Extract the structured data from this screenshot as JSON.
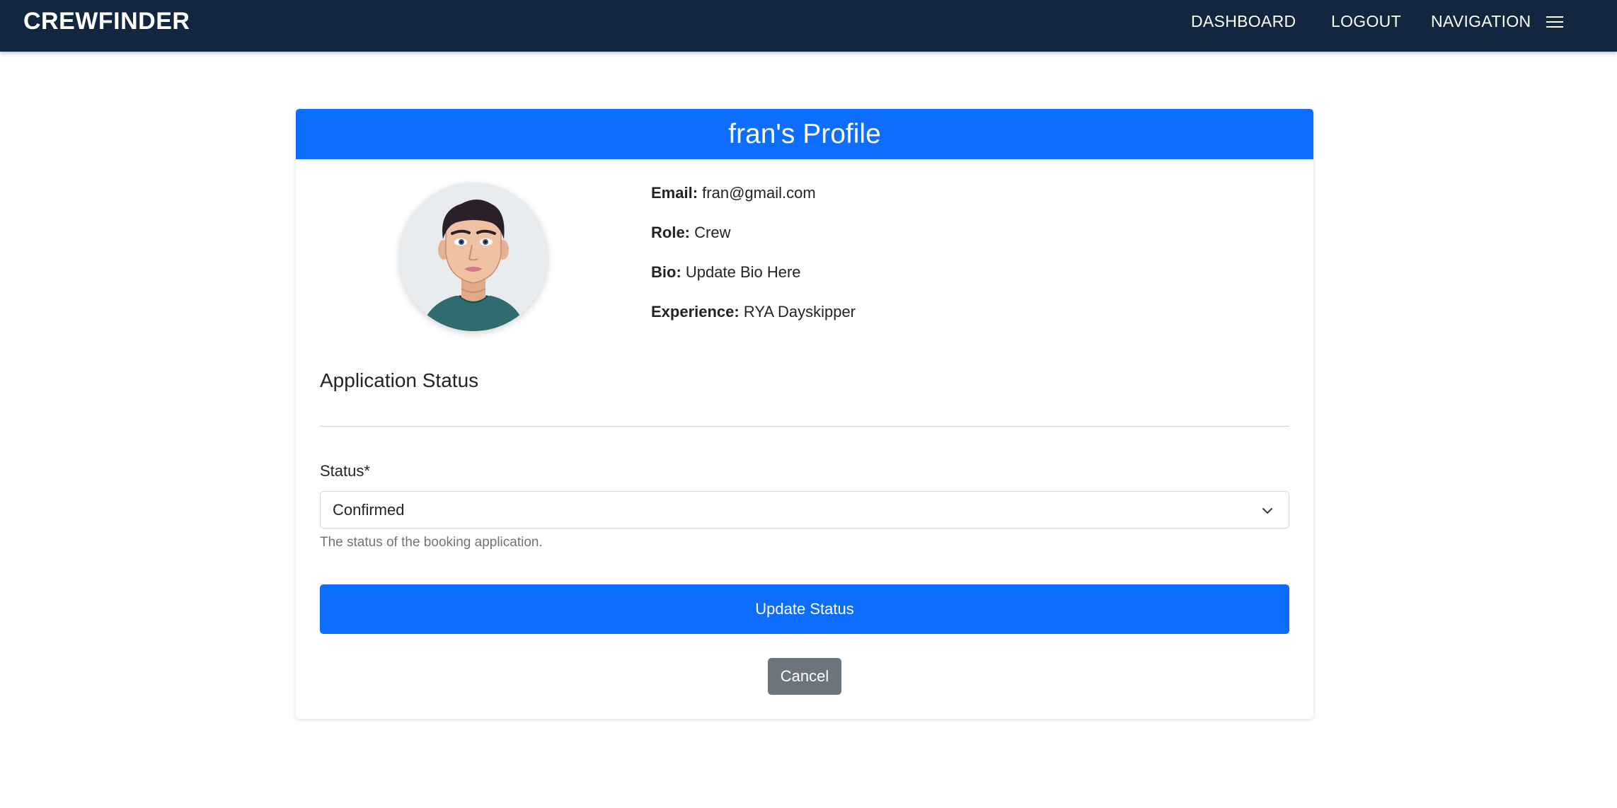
{
  "navbar": {
    "brand": "CREWFINDER",
    "links": {
      "dashboard": "DASHBOARD",
      "logout": "LOGOUT",
      "navigation": "NAVIGATION"
    },
    "menu_icon": "hamburger-menu-icon",
    "background_color": "#132640"
  },
  "profile": {
    "title": "fran's Profile",
    "header_color": "#0d6efd",
    "avatar_icon": "user-avatar-illustration",
    "fields": {
      "email": {
        "label": "Email:",
        "value": "fran@gmail.com"
      },
      "role": {
        "label": "Role:",
        "value": "Crew"
      },
      "bio": {
        "label": "Bio:",
        "value": "Update Bio Here"
      },
      "experience": {
        "label": "Experience:",
        "value": "RYA Dayskipper"
      }
    }
  },
  "application": {
    "section_title": "Application Status",
    "status_label": "Status*",
    "status_value": "Confirmed",
    "help_text": "The status of the booking application.",
    "update_button": "Update Status",
    "cancel_button": "Cancel",
    "chevron_icon": "chevron-down-icon"
  }
}
